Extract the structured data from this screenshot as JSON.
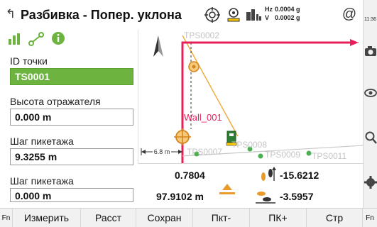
{
  "titlebar": {
    "back_icon": "back-arrow-icon",
    "title": "Разбивка - Попер. уклона",
    "hz_label": "Hz",
    "hz_value": "0.0004 g",
    "v_label": "V",
    "v_value": "0.0002 g",
    "at_symbol": "@",
    "clock": "11:36"
  },
  "left_panel": {
    "icons": [
      "chart-icon",
      "points-link-icon",
      "info-icon"
    ],
    "point_id_label": "ID точки",
    "point_id_value": "TS0001",
    "reflector_height_label": "Высота отражателя",
    "reflector_height_value": "0.000 m",
    "chainage_step_label_1": "Шаг пикетажа",
    "chainage_step_value_1": "9.3255 m",
    "chainage_step_label_2": "Шаг пикетажа",
    "chainage_step_value_2": "0.000 m"
  },
  "map": {
    "labels": {
      "tps0002": "TPS0002",
      "wall": "Wall_001",
      "tps0007": "TPS0007",
      "tps0008": "TPS0008",
      "tps0009": "TPS0009",
      "tps0011": "TPS0011",
      "scale": "6.8 m"
    },
    "colors": {
      "guide": "#e8205a",
      "line": "#f0a83a",
      "point": "#4caf50"
    }
  },
  "readout": {
    "offset_value": "0.7804",
    "distance_value": "97.9102 m",
    "forward_value": "-15.6212",
    "side_value": "-3.5957"
  },
  "right_toolbar": [
    "camera-icon",
    "eye-icon",
    "search-icon",
    "settings-icon"
  ],
  "softkeys": {
    "fn1": "Fn",
    "measure": "Измерить",
    "dist": "Расст",
    "save": "Сохран",
    "pt_minus": "Пкт-",
    "pk_plus": "ПК+",
    "page": "Стр",
    "fn2": "Fn"
  }
}
